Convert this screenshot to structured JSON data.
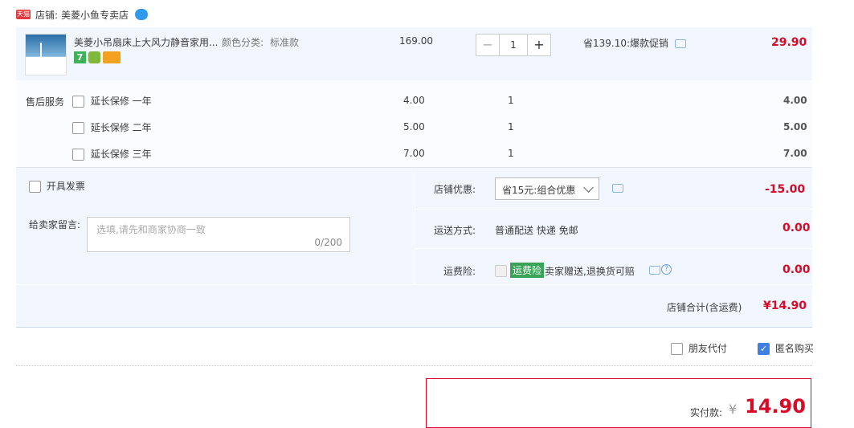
{
  "shop": {
    "badge": "天猫",
    "label": "店铺:",
    "name": "美菱小鱼专卖店"
  },
  "item": {
    "title": "美菱小吊扇床上大风力静音家用...",
    "spec_label": "颜色分类:",
    "spec_value": "标准款",
    "unit_price": "169.00",
    "qty": "1",
    "minus": "−",
    "plus": "+",
    "promo": "省139.10:爆款促销",
    "total": "29.90",
    "tag_label": "7"
  },
  "service": {
    "label": "售后服务",
    "options": [
      {
        "name": "延长保修 一年",
        "price": "4.00",
        "qty": "1",
        "total": "4.00"
      },
      {
        "name": "延长保修 二年",
        "price": "5.00",
        "qty": "1",
        "total": "5.00"
      },
      {
        "name": "延长保修 三年",
        "price": "7.00",
        "qty": "1",
        "total": "7.00"
      }
    ]
  },
  "invoice": {
    "label": "开具发票"
  },
  "message": {
    "label": "给卖家留言:",
    "placeholder": "选填,请先和商家协商一致",
    "counter": "0/200"
  },
  "coupon": {
    "label": "店铺优惠:",
    "selected": "省15元:组合优惠",
    "amount": "-15.00"
  },
  "shipping": {
    "label": "运送方式:",
    "value": "普通配送 快递 免邮",
    "amount": "0.00"
  },
  "insurance": {
    "label": "运费险:",
    "tag": "运费险",
    "desc": "卖家赠送,退换货可赔",
    "amount": "0.00"
  },
  "subtotal": {
    "label": "店铺合计(含运费)",
    "amount": "¥14.90"
  },
  "options": {
    "friend_pay": "朋友代付",
    "anonymous": "匿名购买"
  },
  "payment": {
    "label": "实付款:",
    "currency": "¥",
    "amount": "14.90"
  },
  "colors": {
    "accent_red": "#d80a25",
    "panel_blue": "#f2f7ff",
    "check_blue": "#3d7fe3",
    "tag_green": "#3aa357"
  }
}
